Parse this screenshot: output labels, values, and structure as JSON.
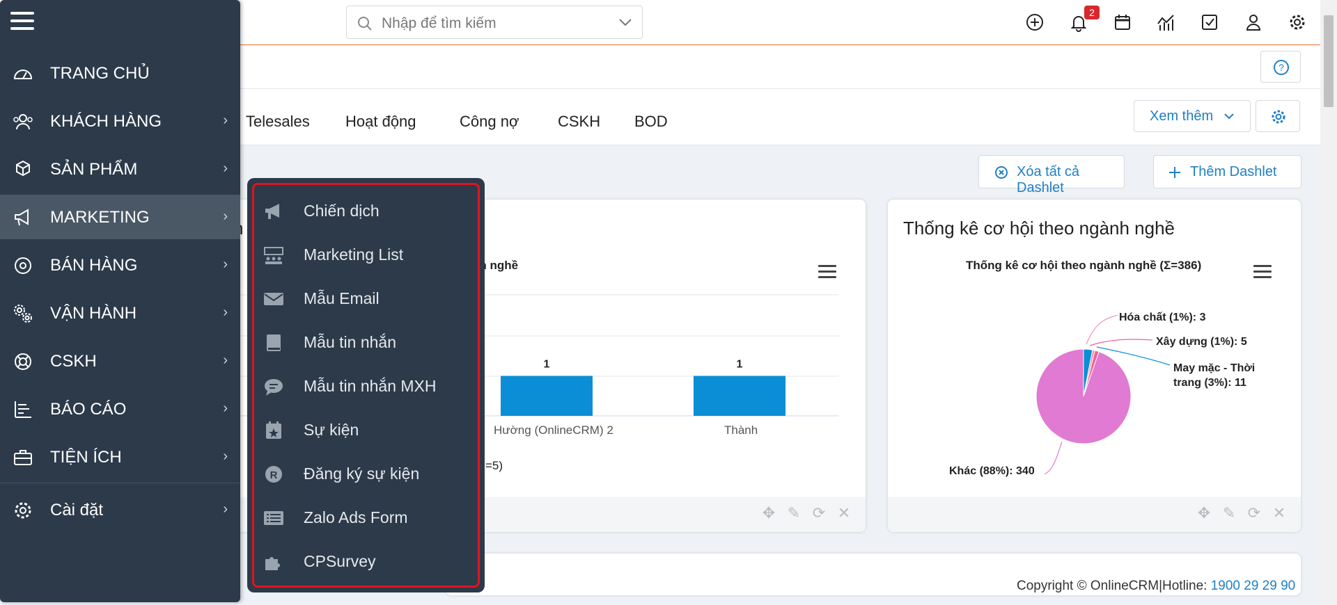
{
  "search": {
    "placeholder": "Nhập để tìm kiếm"
  },
  "notifications": {
    "count": "2"
  },
  "tabs": [
    "Telesales",
    "Hoạt động",
    "Công nợ",
    "CSKH",
    "BOD"
  ],
  "buttons": {
    "see_more": "Xem thêm",
    "clear_dashlets": "Xóa tất cả Dashlet",
    "add_dashlet": "Thêm Dashlet"
  },
  "dashlet_left": {
    "title_partial": "h",
    "chart_title_partial": "nh nghề",
    "bar_labels": [
      "1",
      "1"
    ],
    "categories": [
      "Hường (OnlineCRM) 2",
      "Thành"
    ],
    "bottom_text": "=5)"
  },
  "dashlet_right": {
    "title": "Thống kê cơ hội theo ngành nghề",
    "chart_title": "Thống kê cơ hội theo ngành nghề (Σ=386)"
  },
  "chart_data": [
    {
      "type": "bar",
      "categories": [
        "Hường (OnlineCRM) 2",
        "Thành"
      ],
      "values": [
        1,
        1
      ],
      "color": "#0b8ed6"
    },
    {
      "type": "pie",
      "title": "Thống kê cơ hội theo ngành nghề (Σ=386)",
      "labels": [
        "Khác (88%): 340",
        "Hóa chất (1%): 3",
        "Xây dựng (1%): 5",
        "May mặc - Thời trang (3%): 11"
      ],
      "values": [
        340,
        3,
        5,
        11
      ],
      "colors": [
        "#e07ad2",
        "#f48fb1",
        "#f06292",
        "#0b8ed6"
      ]
    }
  ],
  "copyright": {
    "text": "Copyright © OnlineCRM|Hotline:",
    "hotline": "1900 29 29 90"
  },
  "sidebar": {
    "items": [
      {
        "label": "TRANG CHỦ",
        "icon": "dashboard-icon",
        "arrow": ""
      },
      {
        "label": "KHÁCH HÀNG",
        "icon": "users-icon",
        "arrow": "›"
      },
      {
        "label": "SẢN PHẨM",
        "icon": "cubes-icon",
        "arrow": "›"
      },
      {
        "label": "MARKETING",
        "icon": "megaphone-icon",
        "arrow": "›"
      },
      {
        "label": "BÁN HÀNG",
        "icon": "target-icon",
        "arrow": "›"
      },
      {
        "label": "VẬN HÀNH",
        "icon": "cogs-icon",
        "arrow": "›"
      },
      {
        "label": "CSKH",
        "icon": "lifebuoy-icon",
        "arrow": "›"
      },
      {
        "label": "BÁO CÁO",
        "icon": "report-icon",
        "arrow": "›"
      },
      {
        "label": "TIỆN ÍCH",
        "icon": "briefcase-icon",
        "arrow": "›"
      },
      {
        "label": "Cài đặt",
        "icon": "settings-icon",
        "arrow": "›"
      }
    ]
  },
  "submenu": {
    "items": [
      {
        "label": "Chiến dịch",
        "icon": "bullhorn-icon"
      },
      {
        "label": "Marketing List",
        "icon": "audience-icon"
      },
      {
        "label": "Mẫu Email",
        "icon": "envelope-icon"
      },
      {
        "label": "Mẫu tin nhắn",
        "icon": "book-icon"
      },
      {
        "label": "Mẫu tin nhắn MXH",
        "icon": "chat-icon"
      },
      {
        "label": "Sự kiện",
        "icon": "calendar-star-icon"
      },
      {
        "label": "Đăng ký sự kiện",
        "icon": "registered-icon"
      },
      {
        "label": "Zalo Ads Form",
        "icon": "form-list-icon"
      },
      {
        "label": "CPSurvey",
        "icon": "puzzle-icon"
      }
    ]
  }
}
